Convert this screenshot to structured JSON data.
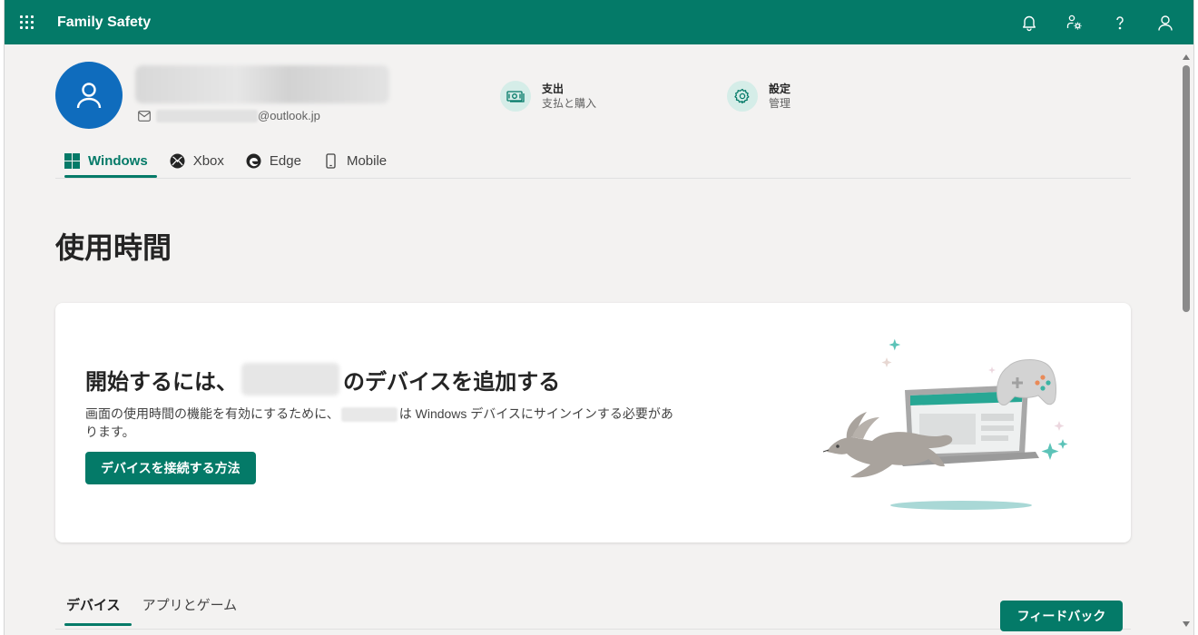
{
  "topbar": {
    "app_title": "Family Safety",
    "icons": [
      "waffle-icon",
      "bell-icon",
      "family-settings-icon",
      "help-icon",
      "account-icon"
    ]
  },
  "profile": {
    "email_suffix": "@outlook.jp",
    "spending": {
      "title": "支出",
      "subtitle": "支払と購入",
      "icon": "money-icon"
    },
    "settings": {
      "title": "設定",
      "subtitle": "管理",
      "icon": "gear-icon"
    }
  },
  "platform_tabs": [
    {
      "label": "Windows",
      "icon": "windows-icon",
      "active": true
    },
    {
      "label": "Xbox",
      "icon": "xbox-icon",
      "active": false
    },
    {
      "label": "Edge",
      "icon": "edge-icon",
      "active": false
    },
    {
      "label": "Mobile",
      "icon": "mobile-icon",
      "active": false
    }
  ],
  "page_title": "使用時間",
  "card": {
    "title_prefix": "開始するには、",
    "title_suffix": "のデバイスを追加する",
    "desc_prefix": "画面の使用時間の機能を有効にするために、",
    "desc_suffix": "は Windows デバイスにサインインする必要があります。",
    "button": "デバイスを接続する方法"
  },
  "bottom_tabs": [
    {
      "label": "デバイス",
      "active": true
    },
    {
      "label": "アプリとゲーム",
      "active": false
    }
  ],
  "feedback_button": "フィードバック",
  "colors": {
    "brand": "#047a68",
    "avatar": "#0f6cbd",
    "icon_bg": "#d5ede8"
  }
}
